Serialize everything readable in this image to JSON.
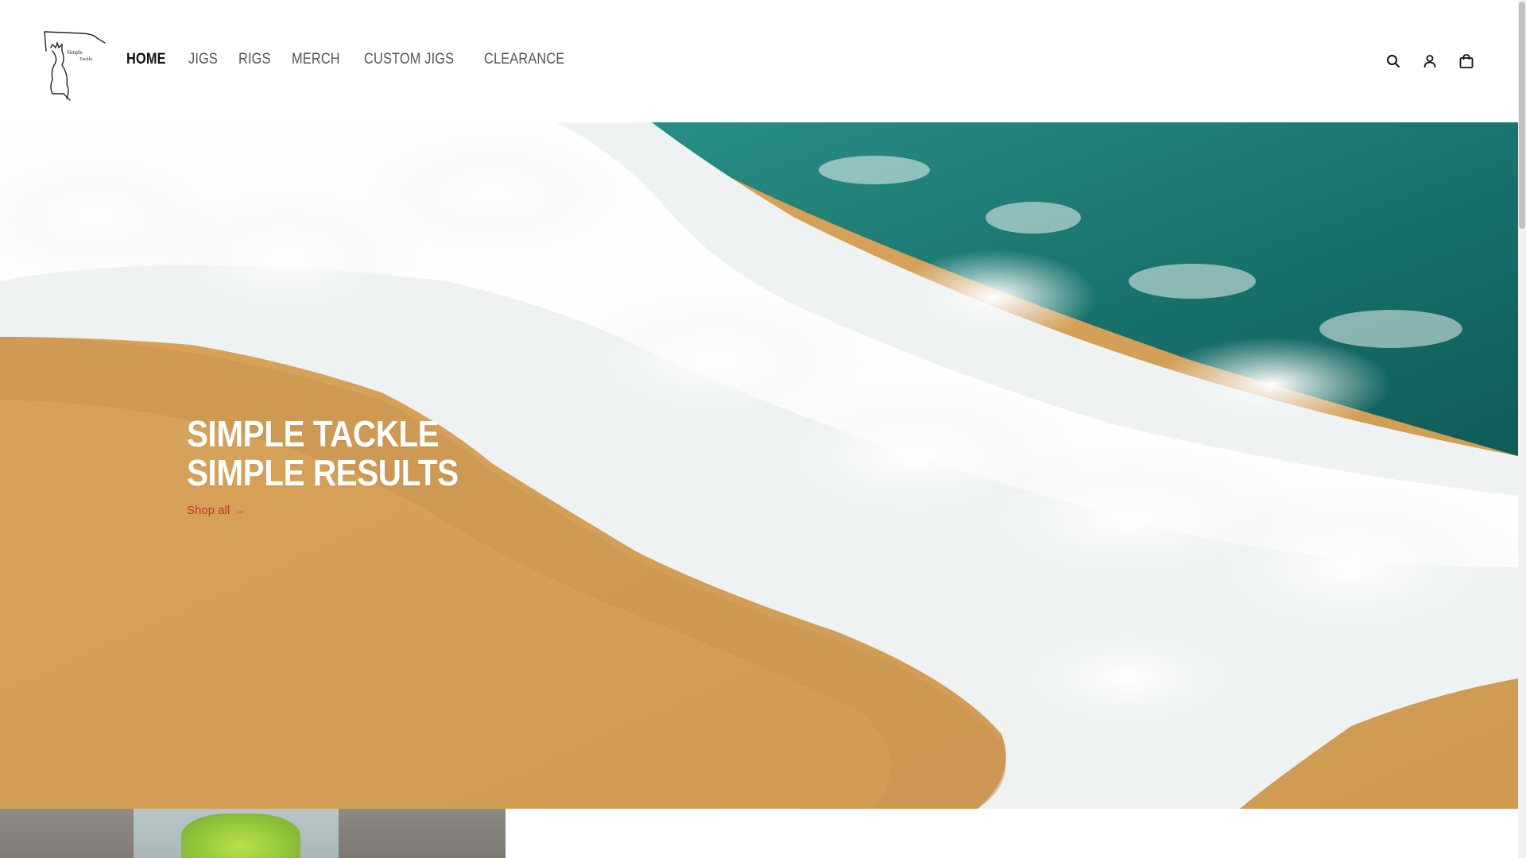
{
  "header": {
    "logo_alt": "Simple Tackle",
    "logo_text_1": "Simple",
    "logo_text_2": "Tackle",
    "nav": [
      {
        "label": "HOME",
        "active": true
      },
      {
        "label": "JIGS",
        "active": false
      },
      {
        "label": "RIGS",
        "active": false
      },
      {
        "label": "MERCH",
        "active": false
      },
      {
        "label": "CUSTOM JIGS",
        "active": false
      },
      {
        "label": "CLEARANCE",
        "active": false
      }
    ],
    "icons": [
      "search-icon",
      "account-icon",
      "cart-icon"
    ]
  },
  "hero": {
    "title_line_1": "SIMPLE TACKLE",
    "title_line_2": "SIMPLE RESULTS",
    "cta_label": "Shop all",
    "cta_arrow": "→"
  },
  "colors": {
    "sand": "#d9a45a",
    "sea": "#1e7d78",
    "foam": "#f3f5f6",
    "link": "#c0392b",
    "nav_active": "#111111",
    "nav_inactive": "#555555"
  }
}
